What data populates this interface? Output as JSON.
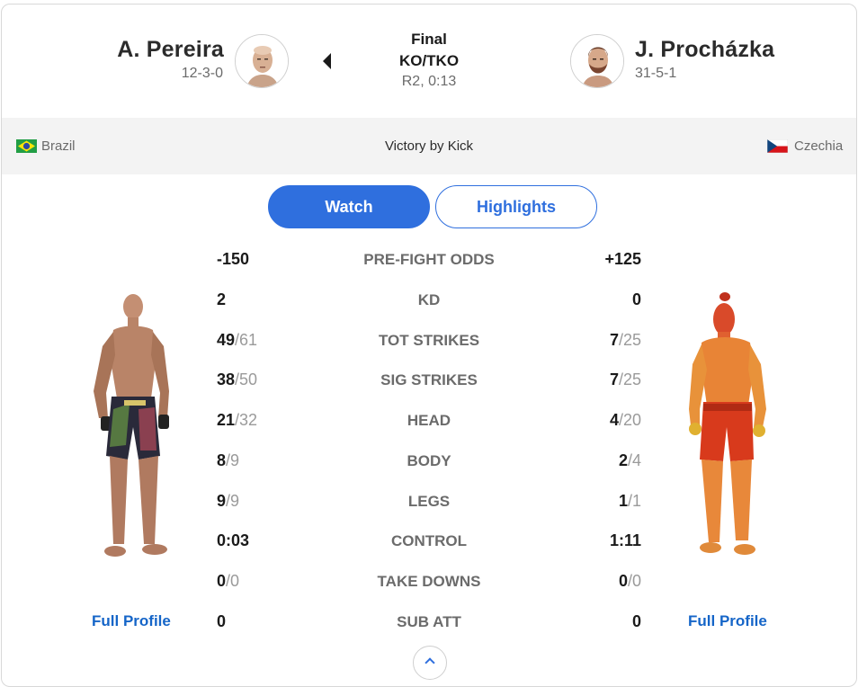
{
  "fight": {
    "status": "Final",
    "method": "KO/TKO",
    "time": "R2, 0:13",
    "victory": "Victory by Kick"
  },
  "left_fighter": {
    "name": "A. Pereira",
    "record": "12-3-0",
    "country": "Brazil",
    "profile_link": "Full Profile"
  },
  "right_fighter": {
    "name": "J. Procházka",
    "record": "31-5-1",
    "country": "Czechia",
    "profile_link": "Full Profile"
  },
  "buttons": {
    "watch": "Watch",
    "highlights": "Highlights"
  },
  "stats": [
    {
      "label": "PRE-FIGHT ODDS",
      "left": "-150",
      "left_of": "",
      "right": "+125",
      "right_of": ""
    },
    {
      "label": "KD",
      "left": "2",
      "left_of": "",
      "right": "0",
      "right_of": ""
    },
    {
      "label": "TOT STRIKES",
      "left": "49",
      "left_of": "/61",
      "right": "7",
      "right_of": "/25"
    },
    {
      "label": "SIG STRIKES",
      "left": "38",
      "left_of": "/50",
      "right": "7",
      "right_of": "/25"
    },
    {
      "label": "HEAD",
      "left": "21",
      "left_of": "/32",
      "right": "4",
      "right_of": "/20"
    },
    {
      "label": "BODY",
      "left": "8",
      "left_of": "/9",
      "right": "2",
      "right_of": "/4"
    },
    {
      "label": "LEGS",
      "left": "9",
      "left_of": "/9",
      "right": "1",
      "right_of": "/1"
    },
    {
      "label": "CONTROL",
      "left": "0:03",
      "left_of": "",
      "right": "1:11",
      "right_of": ""
    },
    {
      "label": "TAKE DOWNS",
      "left": "0",
      "left_of": "/0",
      "right": "0",
      "right_of": "/0"
    },
    {
      "label": "SUB ATT",
      "left": "0",
      "left_of": "",
      "right": "0",
      "right_of": ""
    }
  ],
  "colors": {
    "accent": "#2f6fde",
    "link": "#1565c8",
    "strip_bg": "#f3f3f3"
  },
  "icons": {
    "winner_indicator": "caret-left-icon",
    "scroll": "chevron-up-icon",
    "left_flag": "brazil-flag-icon",
    "right_flag": "czechia-flag-icon"
  }
}
